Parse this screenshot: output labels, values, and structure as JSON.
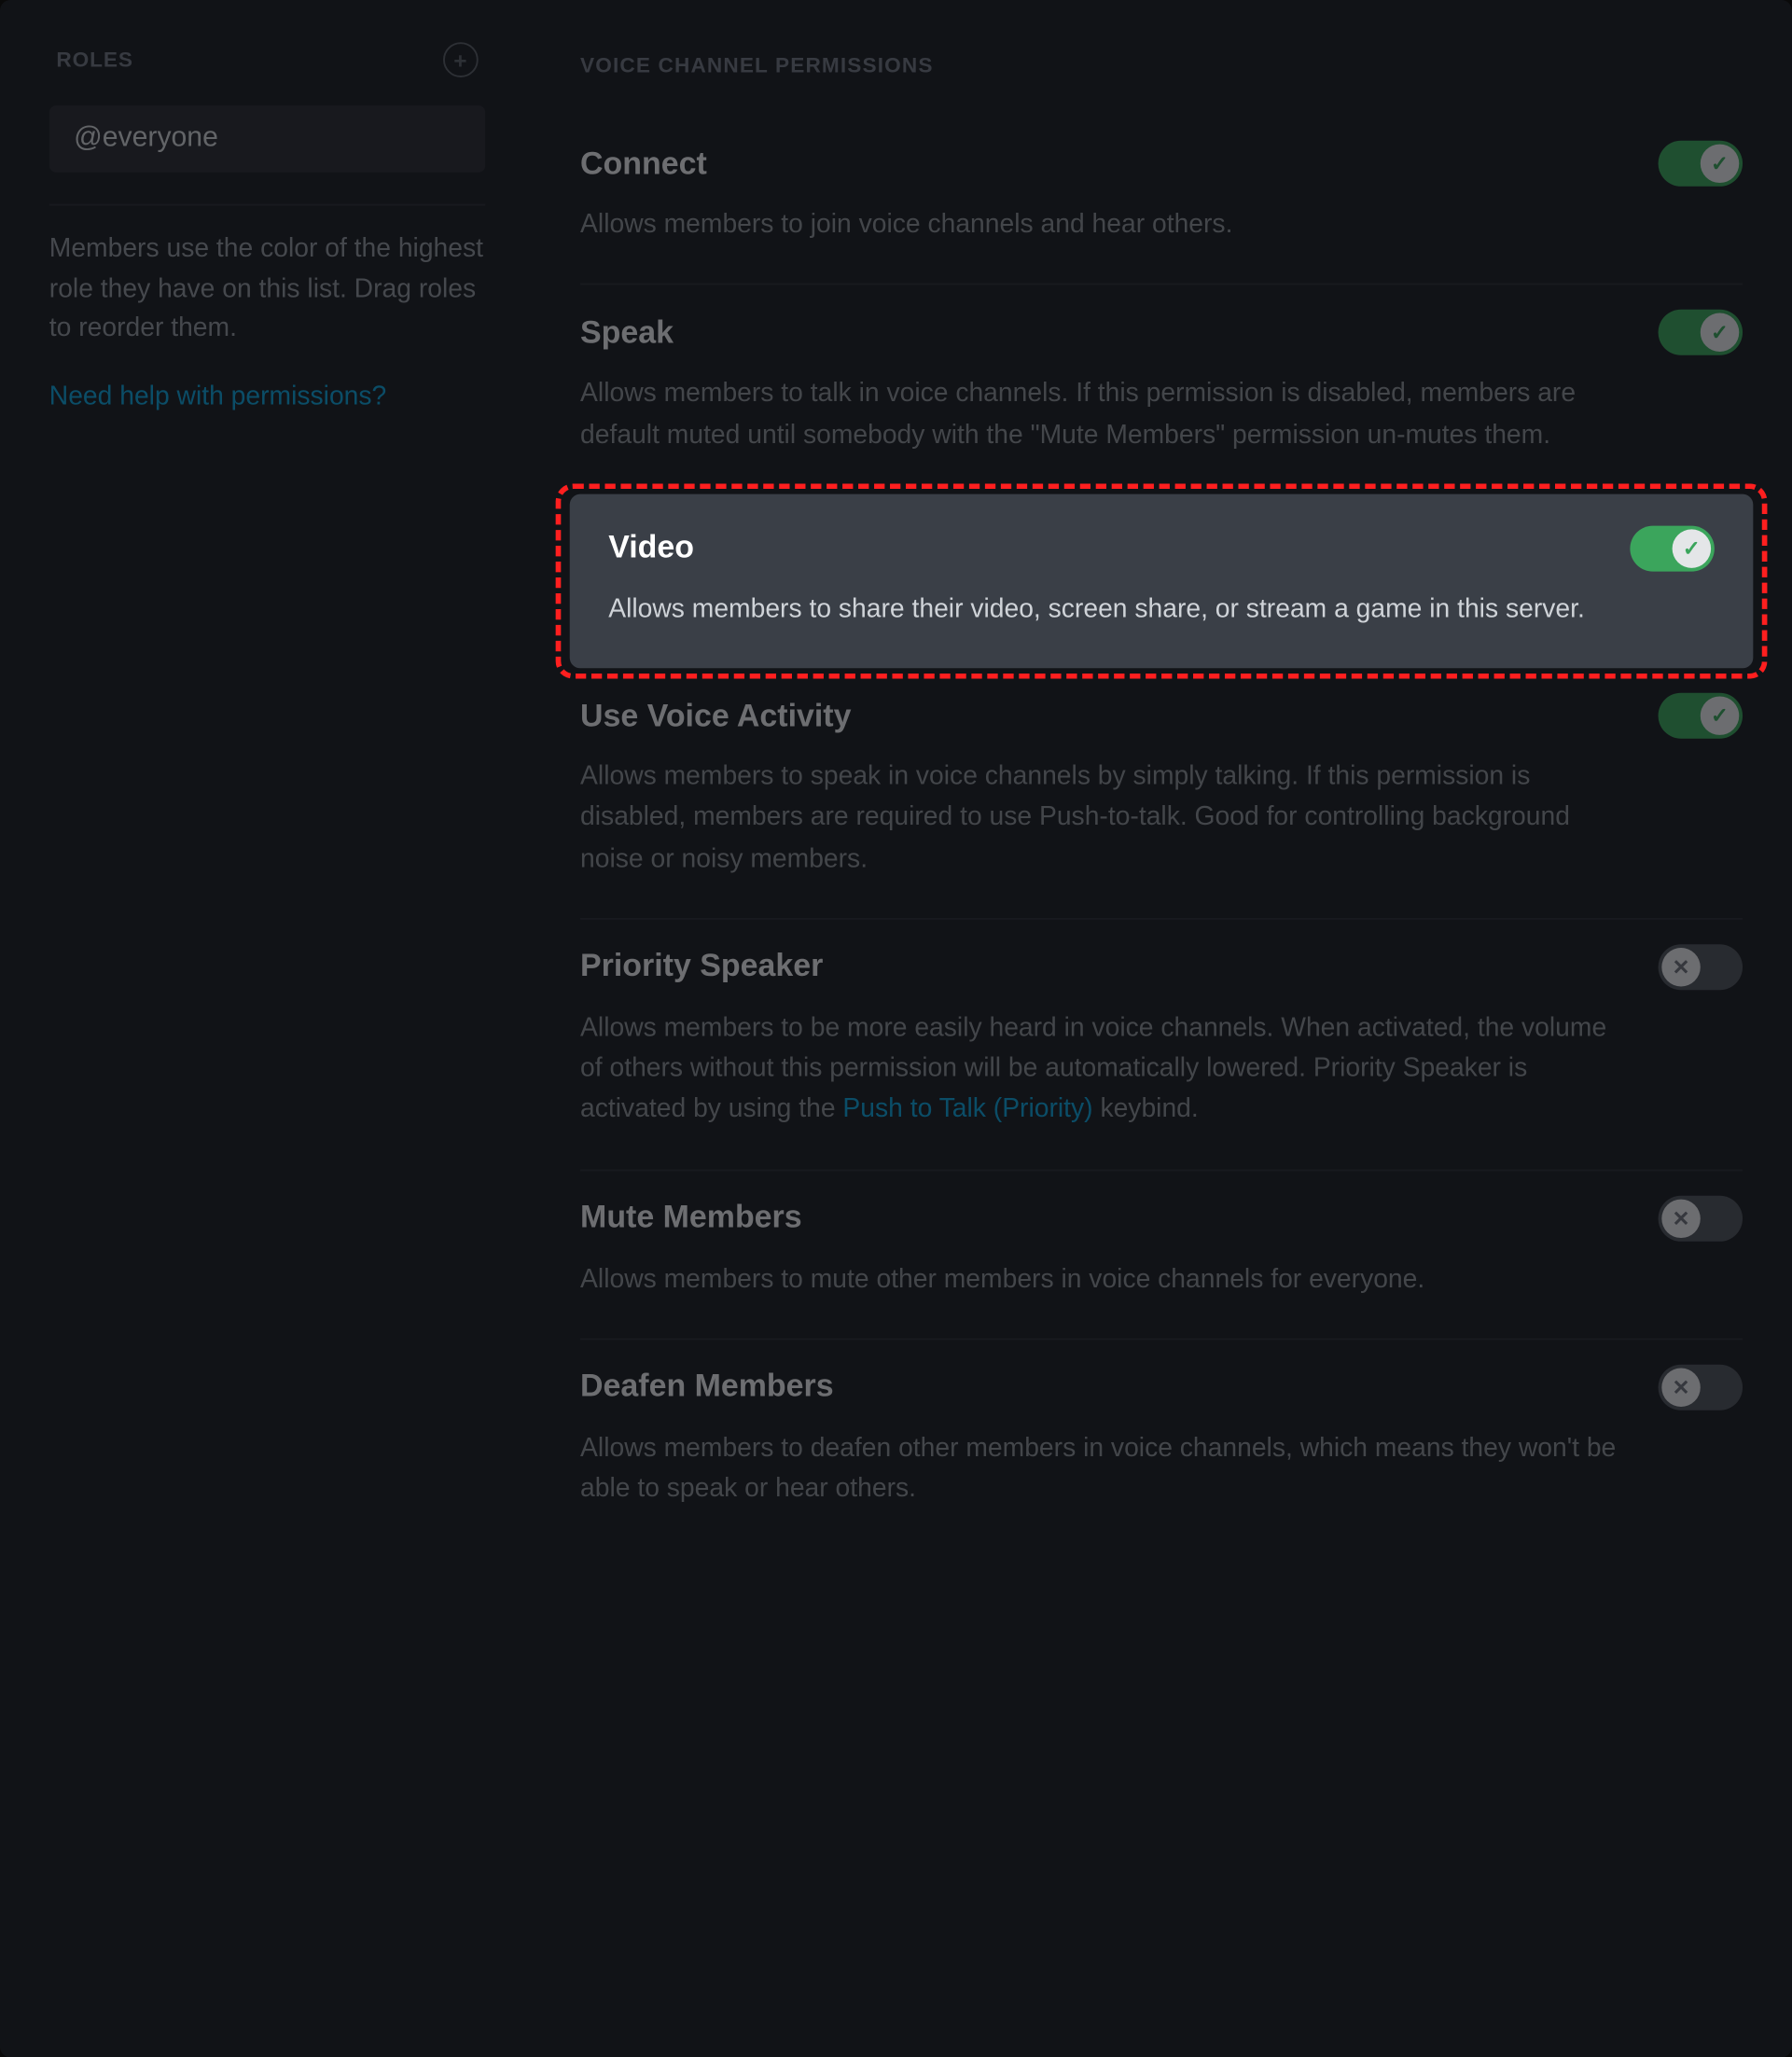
{
  "sidebar": {
    "header": "ROLES",
    "role_label": "@everyone",
    "note": "Members use the color of the highest role they have on this list. Drag roles to reorder them.",
    "help_link": "Need help with permissions?"
  },
  "main": {
    "section_title": "VOICE CHANNEL PERMISSIONS",
    "permissions": [
      {
        "key": "connect",
        "title": "Connect",
        "desc": "Allows members to join voice channels and hear others.",
        "state": "on",
        "highlighted": false
      },
      {
        "key": "speak",
        "title": "Speak",
        "desc": "Allows members to talk in voice channels. If this permission is disabled, members are default muted until somebody with the \"Mute Members\" permission un-mutes them.",
        "state": "on",
        "highlighted": false
      },
      {
        "key": "video",
        "title": "Video",
        "desc": "Allows members to share their video, screen share, or stream a game in this server.",
        "state": "on",
        "highlighted": true
      },
      {
        "key": "use-voice-activity",
        "title": "Use Voice Activity",
        "desc": "Allows members to speak in voice channels by simply talking. If this permission is disabled, members are required to use Push-to-talk. Good for controlling background noise or noisy members.",
        "state": "on",
        "highlighted": false
      },
      {
        "key": "priority-speaker",
        "title": "Priority Speaker",
        "desc_pre": "Allows members to be more easily heard in voice channels. When activated, the volume of others without this permission will be automatically lowered. Priority Speaker is activated by using the ",
        "desc_link": "Push to Talk (Priority)",
        "desc_post": " keybind.",
        "state": "off",
        "highlighted": false
      },
      {
        "key": "mute-members",
        "title": "Mute Members",
        "desc": "Allows members to mute other members in voice channels for everyone.",
        "state": "off",
        "highlighted": false
      },
      {
        "key": "deafen-members",
        "title": "Deafen Members",
        "desc": "Allows members to deafen other members in voice channels, which means they won't be able to speak or hear others.",
        "state": "off",
        "highlighted": false
      }
    ]
  },
  "annotation": {
    "highlight_key": "video"
  }
}
